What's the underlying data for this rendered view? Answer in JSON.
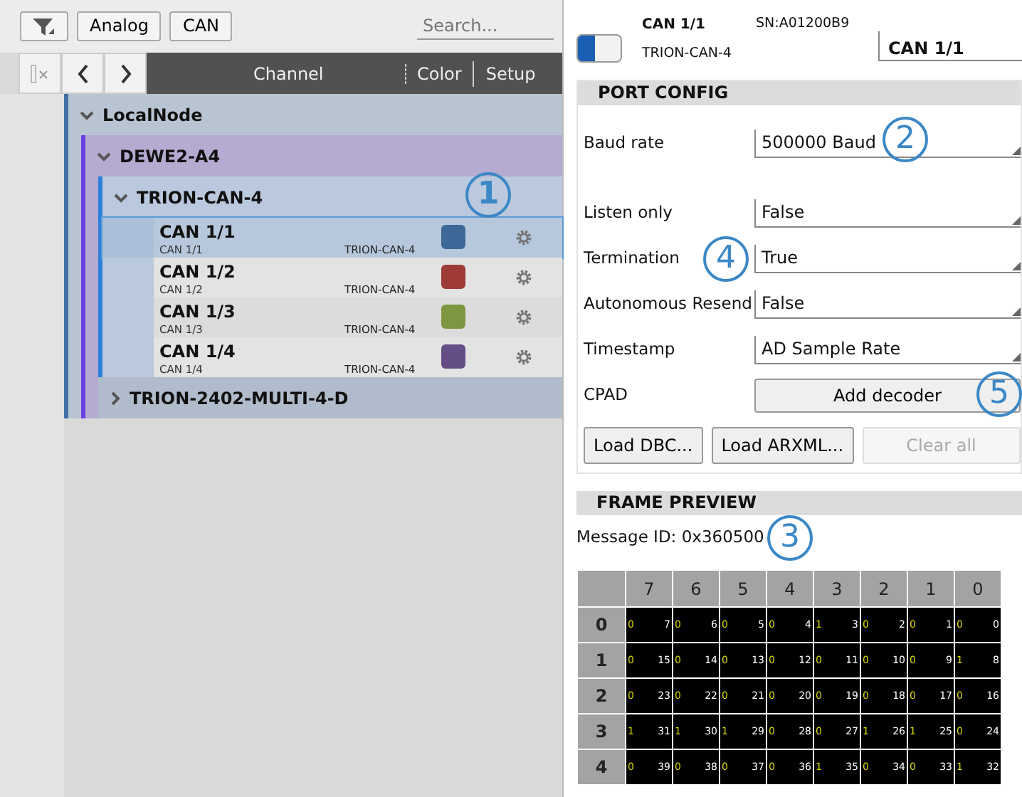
{
  "toolbar": {
    "filters": [
      {
        "label": "Analog"
      },
      {
        "label": "CAN"
      }
    ],
    "search": {
      "placeholder": "Search..."
    }
  },
  "columns": [
    "Channel",
    "Color",
    "Setup"
  ],
  "tree": [
    {
      "label": "LocalNode",
      "expanded": true,
      "children": [
        {
          "label": "DEWE2-A4",
          "expanded": true,
          "children": [
            {
              "label": "TRION-CAN-4",
              "expanded": true,
              "callout": "1",
              "channels": [
                {
                  "name": "CAN 1/1",
                  "sub": "CAN 1/1",
                  "device": "TRION-CAN-4",
                  "color": "#3e6897",
                  "selected": true
                },
                {
                  "name": "CAN 1/2",
                  "sub": "CAN 1/2",
                  "device": "TRION-CAN-4",
                  "color": "#9e3b37",
                  "selected": false
                },
                {
                  "name": "CAN 1/3",
                  "sub": "CAN 1/3",
                  "device": "TRION-CAN-4",
                  "color": "#7d9640",
                  "selected": false
                },
                {
                  "name": "CAN 1/4",
                  "sub": "CAN 1/4",
                  "device": "TRION-CAN-4",
                  "color": "#654e85",
                  "selected": false
                }
              ]
            },
            {
              "label": "TRION-2402-MULTI-4-D",
              "expanded": false
            }
          ]
        }
      ]
    }
  ],
  "detail": {
    "enabled": true,
    "channel": "CAN 1/1",
    "device": "TRION-CAN-4",
    "serial": "SN:A01200B9",
    "name_value": "CAN 1/1"
  },
  "port_config": {
    "title": "PORT CONFIG",
    "fields": [
      {
        "kind": "select",
        "label": "Baud rate",
        "value": "500000 Baud",
        "callout": "2"
      },
      {
        "kind": "select",
        "label": "Listen only",
        "value": "False"
      },
      {
        "kind": "select",
        "label": "Termination",
        "value": "True",
        "callout": "4"
      },
      {
        "kind": "select",
        "label": "Autonomous Resend",
        "value": "False"
      },
      {
        "kind": "select",
        "label": "Timestamp",
        "value": "AD Sample Rate"
      },
      {
        "kind": "button",
        "label": "CPAD",
        "value": "Add decoder",
        "callout": "5"
      }
    ],
    "buttons": [
      {
        "label": "Load DBC...",
        "disabled": false
      },
      {
        "label": "Load ARXML...",
        "disabled": false
      },
      {
        "label": "Clear all",
        "disabled": true
      }
    ]
  },
  "frame_preview": {
    "title": "FRAME PREVIEW",
    "message_id": "Message ID: 0x360500",
    "callout": "3",
    "columns": [
      "7",
      "6",
      "5",
      "4",
      "3",
      "2",
      "1",
      "0"
    ],
    "rows": [
      {
        "label": "0",
        "cells": [
          {
            "bit": "0",
            "index": "7"
          },
          {
            "bit": "0",
            "index": "6"
          },
          {
            "bit": "0",
            "index": "5"
          },
          {
            "bit": "0",
            "index": "4"
          },
          {
            "bit": "1",
            "index": "3"
          },
          {
            "bit": "0",
            "index": "2"
          },
          {
            "bit": "0",
            "index": "1"
          },
          {
            "bit": "0",
            "index": "0"
          }
        ]
      },
      {
        "label": "1",
        "cells": [
          {
            "bit": "0",
            "index": "15"
          },
          {
            "bit": "0",
            "index": "14"
          },
          {
            "bit": "0",
            "index": "13"
          },
          {
            "bit": "0",
            "index": "12"
          },
          {
            "bit": "0",
            "index": "11"
          },
          {
            "bit": "0",
            "index": "10"
          },
          {
            "bit": "0",
            "index": "9"
          },
          {
            "bit": "1",
            "index": "8"
          }
        ]
      },
      {
        "label": "2",
        "cells": [
          {
            "bit": "0",
            "index": "23"
          },
          {
            "bit": "0",
            "index": "22"
          },
          {
            "bit": "0",
            "index": "21"
          },
          {
            "bit": "0",
            "index": "20"
          },
          {
            "bit": "0",
            "index": "19"
          },
          {
            "bit": "0",
            "index": "18"
          },
          {
            "bit": "0",
            "index": "17"
          },
          {
            "bit": "0",
            "index": "16"
          }
        ]
      },
      {
        "label": "3",
        "cells": [
          {
            "bit": "1",
            "index": "31"
          },
          {
            "bit": "1",
            "index": "30"
          },
          {
            "bit": "1",
            "index": "29"
          },
          {
            "bit": "0",
            "index": "28"
          },
          {
            "bit": "0",
            "index": "27"
          },
          {
            "bit": "1",
            "index": "26"
          },
          {
            "bit": "1",
            "index": "25"
          },
          {
            "bit": "0",
            "index": "24"
          }
        ]
      },
      {
        "label": "4",
        "cells": [
          {
            "bit": "0",
            "index": "39"
          },
          {
            "bit": "0",
            "index": "38"
          },
          {
            "bit": "0",
            "index": "37"
          },
          {
            "bit": "0",
            "index": "36"
          },
          {
            "bit": "1",
            "index": "35"
          },
          {
            "bit": "0",
            "index": "34"
          },
          {
            "bit": "0",
            "index": "33"
          },
          {
            "bit": "1",
            "index": "32"
          }
        ]
      }
    ]
  }
}
